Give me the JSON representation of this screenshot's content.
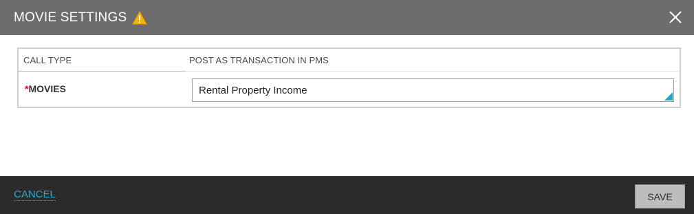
{
  "dialog": {
    "title": "MOVIE SETTINGS",
    "title_icon": "warning-icon",
    "close_icon": "close-icon"
  },
  "table": {
    "columns": [
      "CALL TYPE",
      "POST AS TRANSACTION IN PMS"
    ],
    "rows": [
      {
        "required_marker": "*",
        "label": "MOVIES",
        "value": "Rental Property Income"
      }
    ]
  },
  "footer": {
    "cancel_label": "CANCEL",
    "save_label": "SAVE"
  },
  "colors": {
    "header_bg": "#6d6d6d",
    "footer_bg": "#2b2b2b",
    "link": "#29a8d8",
    "required": "#d0021b",
    "warning": "#f5b400",
    "accent": "#1aa7d6"
  }
}
